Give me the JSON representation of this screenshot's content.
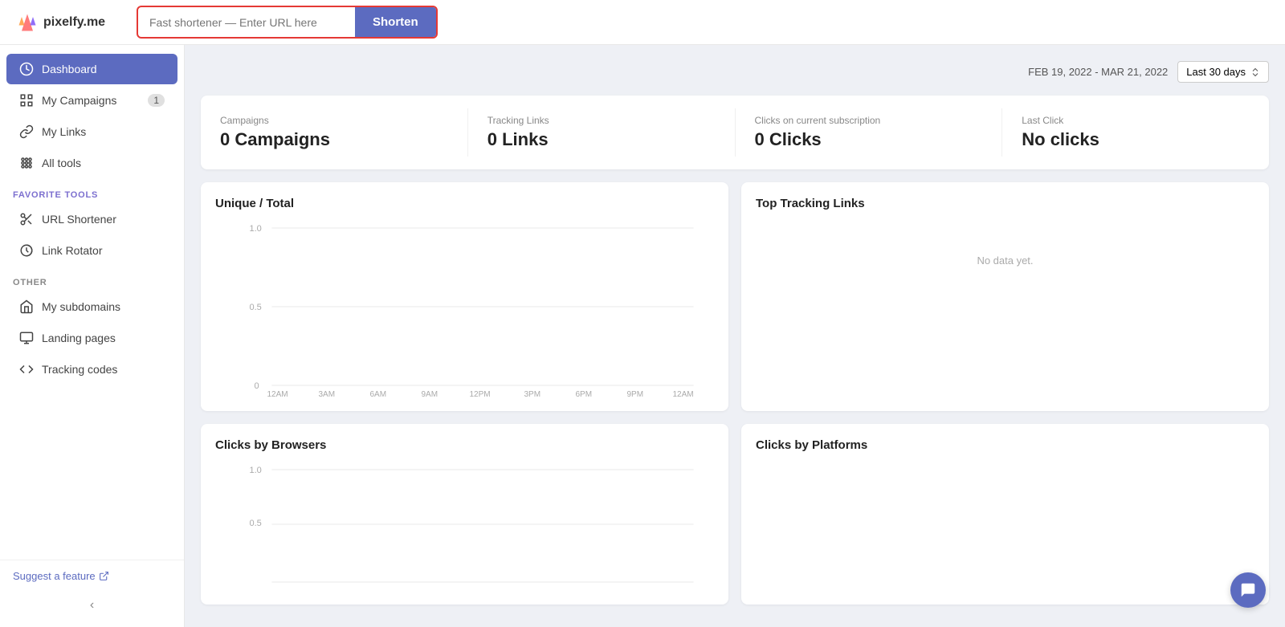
{
  "logo": {
    "text": "pixelfy.me"
  },
  "topbar": {
    "url_input_placeholder": "Fast shortener — Enter URL here",
    "shorten_button": "Shorten"
  },
  "sidebar": {
    "nav_items": [
      {
        "id": "dashboard",
        "label": "Dashboard",
        "icon": "dashboard-icon",
        "active": true,
        "badge": null
      },
      {
        "id": "my-campaigns",
        "label": "My Campaigns",
        "icon": "campaigns-icon",
        "active": false,
        "badge": "1"
      },
      {
        "id": "my-links",
        "label": "My Links",
        "icon": "links-icon",
        "active": false,
        "badge": null
      },
      {
        "id": "all-tools",
        "label": "All tools",
        "icon": "tools-icon",
        "active": false,
        "badge": null
      }
    ],
    "favorite_tools_label": "FAVORITE TOOLS",
    "favorite_tools": [
      {
        "id": "url-shortener",
        "label": "URL Shortener",
        "icon": "scissors-icon"
      },
      {
        "id": "link-rotator",
        "label": "Link Rotator",
        "icon": "rotator-icon"
      }
    ],
    "other_label": "OTHER",
    "other_items": [
      {
        "id": "my-subdomains",
        "label": "My subdomains",
        "icon": "subdomain-icon"
      },
      {
        "id": "landing-pages",
        "label": "Landing pages",
        "icon": "landing-icon"
      },
      {
        "id": "tracking-codes",
        "label": "Tracking codes",
        "icon": "tracking-icon"
      }
    ],
    "suggest_feature": "Suggest a feature",
    "collapse_arrow": "‹"
  },
  "date_header": {
    "date_range": "FEB 19, 2022 - MAR 21, 2022",
    "dropdown_label": "Last 30 days"
  },
  "stats": [
    {
      "label": "Campaigns",
      "value": "0 Campaigns"
    },
    {
      "label": "Tracking Links",
      "value": "0 Links"
    },
    {
      "label": "Clicks on current subscription",
      "value": "0 Clicks"
    },
    {
      "label": "Last Click",
      "value": "No clicks"
    }
  ],
  "charts": {
    "unique_total": {
      "title": "Unique / Total",
      "x_labels": [
        "12AM",
        "3AM",
        "6AM",
        "9AM",
        "12PM",
        "3PM",
        "6PM",
        "9PM",
        "12AM"
      ],
      "y_labels": [
        "1.0",
        "0.5",
        "0"
      ]
    },
    "top_tracking_links": {
      "title": "Top Tracking Links",
      "no_data": "No data yet."
    },
    "clicks_by_browsers": {
      "title": "Clicks by Browsers",
      "y_labels": [
        "1.0",
        "0.5"
      ]
    },
    "clicks_by_platforms": {
      "title": "Clicks by Platforms"
    }
  }
}
